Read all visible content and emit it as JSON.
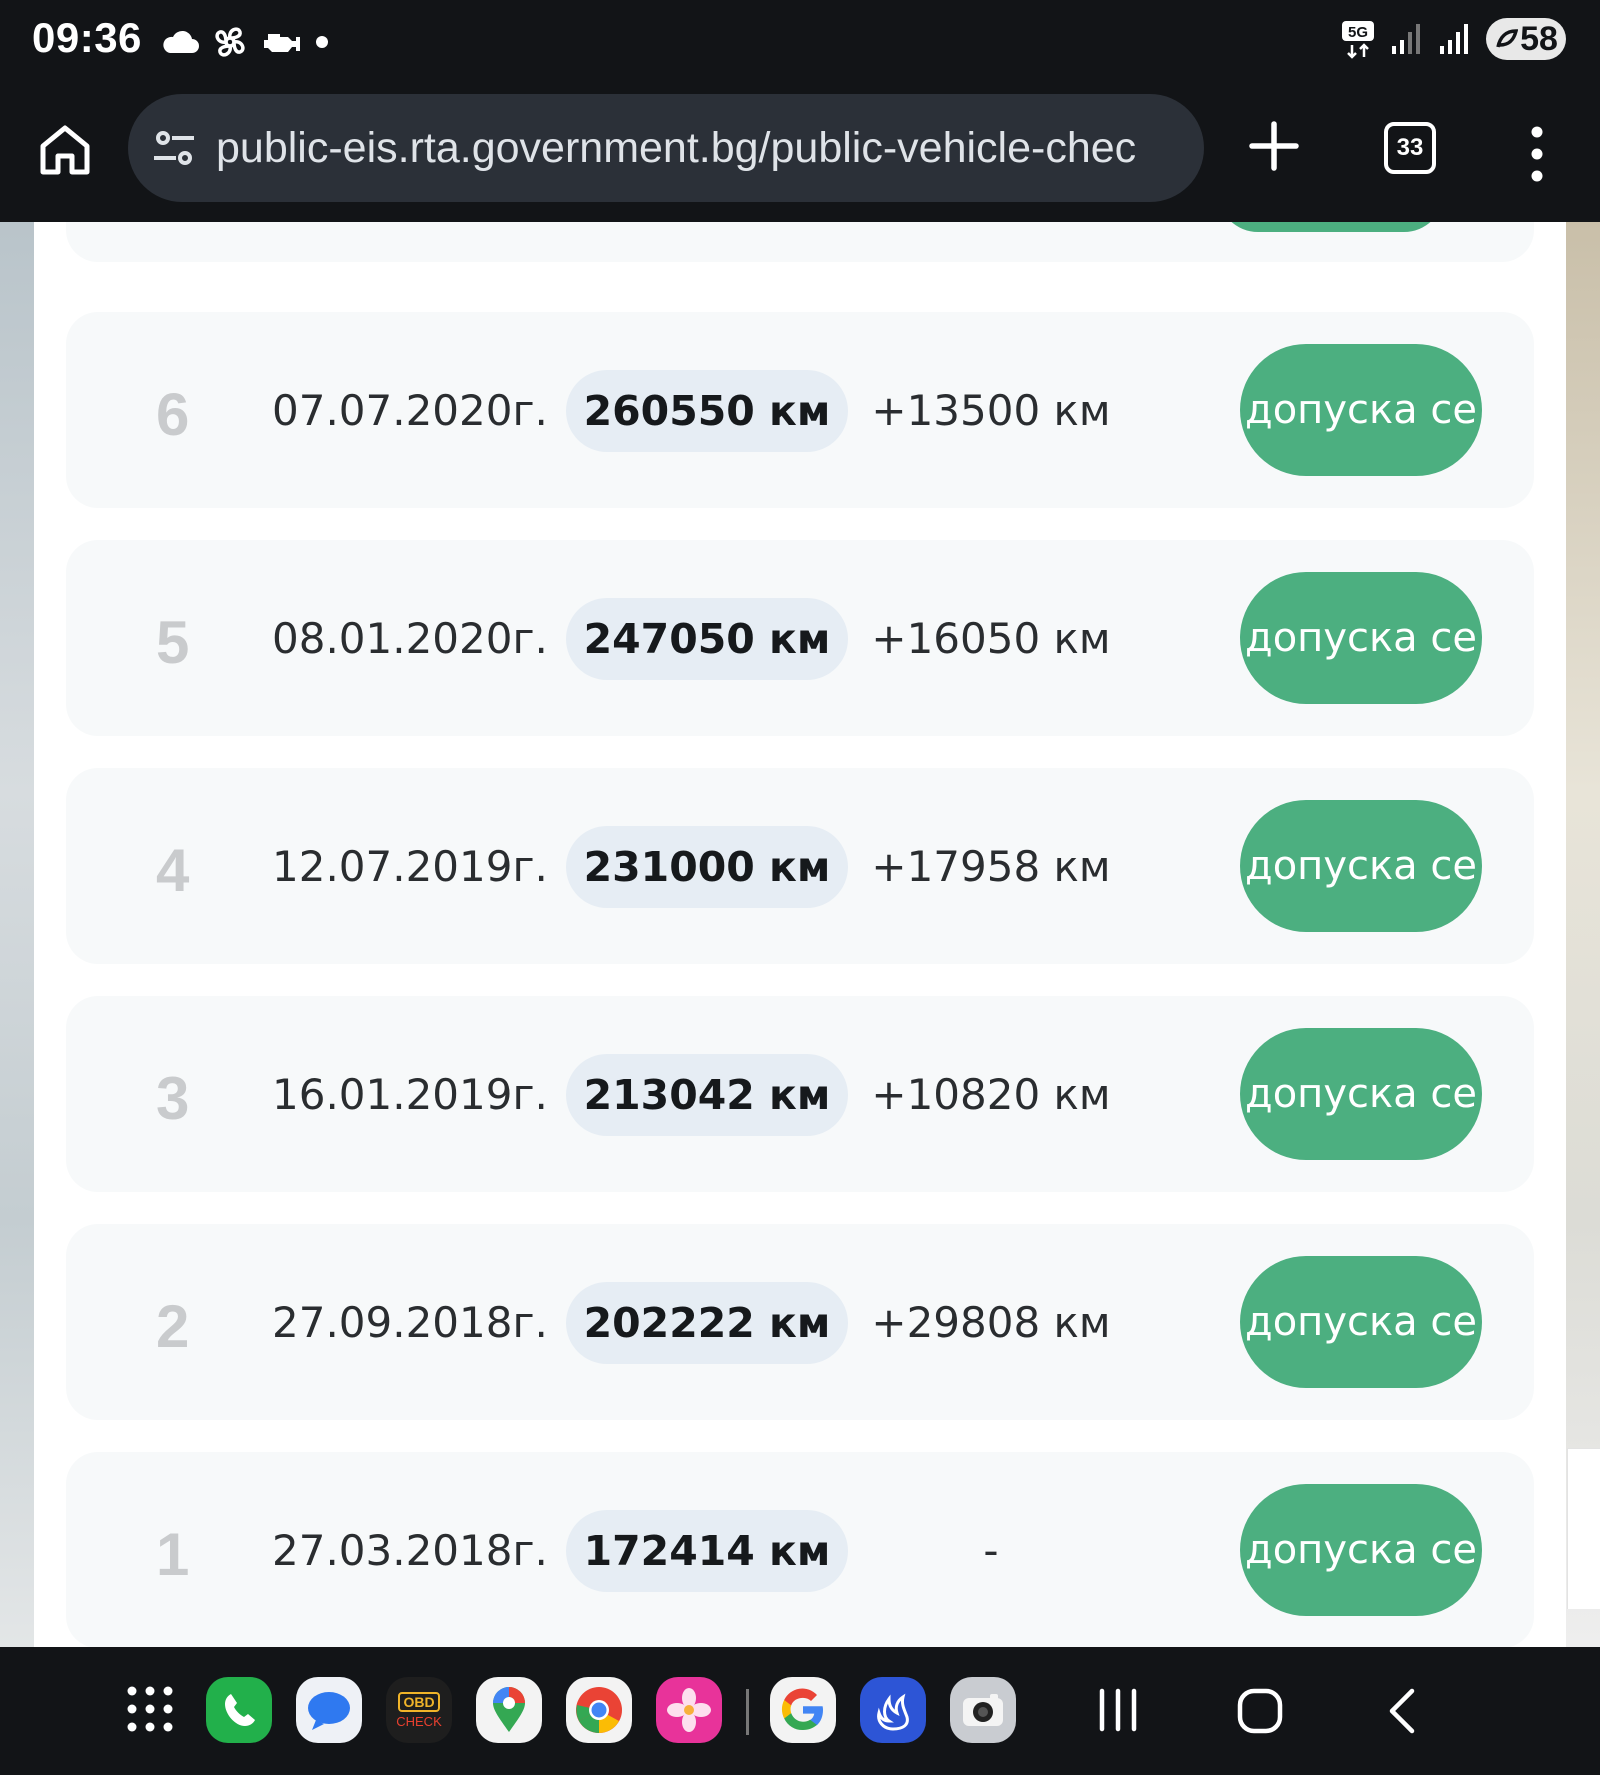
{
  "status_bar": {
    "time": "09:36",
    "network": "5G",
    "battery": "58"
  },
  "browser": {
    "url": "public-eis.rta.government.bg/public-vehicle-chec",
    "tab_count": "33"
  },
  "records": [
    {
      "num": "6",
      "date": "07.07.2020г.",
      "mileage": "260550 км",
      "diff": "+13500 км",
      "status": "допуска се"
    },
    {
      "num": "5",
      "date": "08.01.2020г.",
      "mileage": "247050 км",
      "diff": "+16050 км",
      "status": "допуска се"
    },
    {
      "num": "4",
      "date": "12.07.2019г.",
      "mileage": "231000 км",
      "diff": "+17958 км",
      "status": "допуска се"
    },
    {
      "num": "3",
      "date": "16.01.2019г.",
      "mileage": "213042 км",
      "diff": "+10820 км",
      "status": "допуска се"
    },
    {
      "num": "2",
      "date": "27.09.2018г.",
      "mileage": "202222 км",
      "diff": "+29808 км",
      "status": "допуска се"
    },
    {
      "num": "1",
      "date": "27.03.2018г.",
      "mileage": "172414 км",
      "diff": "-",
      "status": "допуска се"
    }
  ],
  "dock": {
    "obd_label_top": "OBD",
    "obd_label_bottom": "CHECK"
  },
  "colors": {
    "status_green": "#4caf80",
    "mileage_pill": "#e6edf4",
    "card_bg": "#f7f9fa",
    "system_bar": "#121417"
  }
}
